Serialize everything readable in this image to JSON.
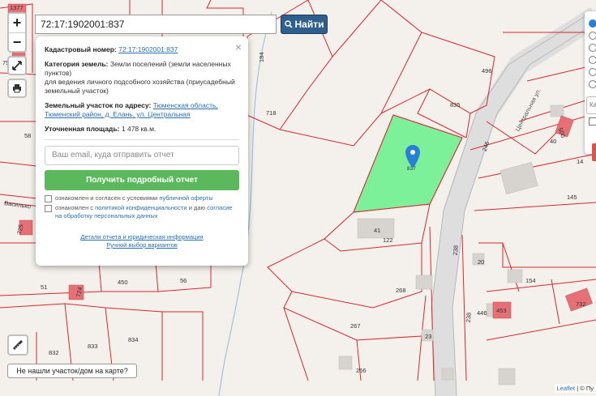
{
  "search": {
    "value": "72:17:1902001:837",
    "button_label": "Найти"
  },
  "zoom": {
    "in": "+",
    "out": "−"
  },
  "popup": {
    "cadastral_label": "Кадастровый номер:",
    "cadastral_value": "72:17:1902001:837",
    "category_label": "Категория земель:",
    "category_value": "Земли поселений (земли населенных пунктов)",
    "purpose": "для ведения личного подсобного хозяйства (приусадебный земельный участок)",
    "address_label": "Земельный участок по адресу:",
    "address_value": "Тюменская область, Тюменский район, д. Елань, ул. Центральная",
    "area_label": "Уточненная площадь:",
    "area_value": "1 478 кв.м.",
    "email_placeholder": "Ваш email, куда отправить отчет",
    "report_button": "Получить подробный отчет",
    "agree1_prefix": "ознакомлен и согласен с условиями",
    "agree1_link": "публичной оферты",
    "agree2_prefix": "ознакомлен с",
    "agree2_link1": "политикой конфиденциальности",
    "agree2_middle": "и даю",
    "agree2_link2": "согласие на обработку персональных данных",
    "details_link": "Детали отчета и юридическая информация",
    "manual_link": "Ручной выбор вариантов",
    "close": "×"
  },
  "notfound_button": "Не нашли участок/дом на карте?",
  "attribution": {
    "leaflet": "Leaflet",
    "sep": "| © Пу"
  },
  "right_panel": {
    "select_text": "Ка"
  },
  "map_labels": [
    {
      "id": "l1",
      "text": "1377"
    },
    {
      "id": "l2",
      "text": "75"
    },
    {
      "id": "l3",
      "text": "58"
    },
    {
      "id": "l4",
      "text": "Василько"
    },
    {
      "id": "l5",
      "text": "725"
    },
    {
      "id": "l6",
      "text": "51"
    },
    {
      "id": "l7",
      "text": "724"
    },
    {
      "id": "l8",
      "text": "450"
    },
    {
      "id": "l9",
      "text": "56"
    },
    {
      "id": "l10",
      "text": "832"
    },
    {
      "id": "l11",
      "text": "833"
    },
    {
      "id": "l12",
      "text": "834"
    },
    {
      "id": "l13",
      "text": "184"
    },
    {
      "id": "l14",
      "text": "718"
    },
    {
      "id": "l15",
      "text": "496"
    },
    {
      "id": "l16",
      "text": "835"
    },
    {
      "id": "l17",
      "text": "246"
    },
    {
      "id": "l18",
      "text": "Центральная ул."
    },
    {
      "id": "l19",
      "text": "837"
    },
    {
      "id": "l20",
      "text": "41"
    },
    {
      "id": "l21",
      "text": "122"
    },
    {
      "id": "l22",
      "text": "238"
    },
    {
      "id": "l23",
      "text": "268"
    },
    {
      "id": "l24",
      "text": "267"
    },
    {
      "id": "l25",
      "text": "23"
    },
    {
      "id": "l26",
      "text": "266"
    },
    {
      "id": "l27",
      "text": "238"
    },
    {
      "id": "l28",
      "text": "145"
    },
    {
      "id": "l29",
      "text": "154"
    },
    {
      "id": "l30",
      "text": "446"
    },
    {
      "id": "l31",
      "text": "453"
    },
    {
      "id": "l32",
      "text": "732"
    },
    {
      "id": "l33",
      "text": "14"
    },
    {
      "id": "l34",
      "text": "500"
    },
    {
      "id": "l35",
      "text": "40"
    },
    {
      "id": "l36",
      "text": "20"
    }
  ],
  "colors": {
    "parcel_line": "#d9262e",
    "selected_fill": "#7df09a",
    "marker": "#2a7fd4",
    "road": "#c8c8c8"
  }
}
